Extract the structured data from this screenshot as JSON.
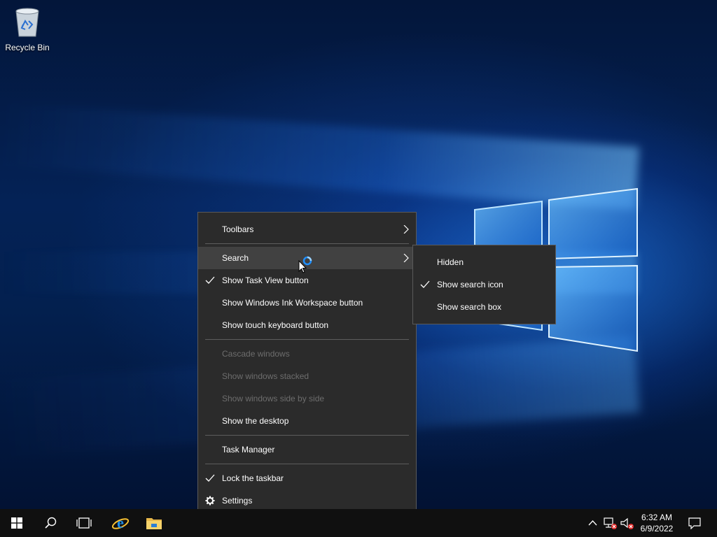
{
  "desktop": {
    "icons": [
      {
        "label": "Recycle Bin",
        "icon": "recycle-bin-icon"
      }
    ]
  },
  "context_menu": {
    "items": [
      {
        "label": "Toolbars",
        "checked": false,
        "enabled": true,
        "submenu": true
      },
      {
        "label": "Search",
        "checked": false,
        "enabled": true,
        "submenu": true,
        "highlighted": true
      },
      {
        "label": "Show Task View button",
        "checked": true,
        "enabled": true
      },
      {
        "label": "Show Windows Ink Workspace button",
        "checked": false,
        "enabled": true
      },
      {
        "label": "Show touch keyboard button",
        "checked": false,
        "enabled": true
      },
      {
        "label": "Cascade windows",
        "checked": false,
        "enabled": false
      },
      {
        "label": "Show windows stacked",
        "checked": false,
        "enabled": false
      },
      {
        "label": "Show windows side by side",
        "checked": false,
        "enabled": false
      },
      {
        "label": "Show the desktop",
        "checked": false,
        "enabled": true
      },
      {
        "label": "Task Manager",
        "checked": false,
        "enabled": true
      },
      {
        "label": "Lock the taskbar",
        "checked": true,
        "enabled": true
      },
      {
        "label": "Settings",
        "checked": false,
        "enabled": true,
        "icon": "gear-icon"
      }
    ]
  },
  "search_submenu": {
    "items": [
      {
        "label": "Hidden",
        "checked": false
      },
      {
        "label": "Show search icon",
        "checked": true
      },
      {
        "label": "Show search box",
        "checked": false
      }
    ]
  },
  "taskbar": {
    "pinned": [
      {
        "icon": "windows-start-icon"
      },
      {
        "icon": "search-icon"
      },
      {
        "icon": "task-view-icon"
      },
      {
        "icon": "internet-explorer-icon"
      },
      {
        "icon": "file-explorer-icon"
      }
    ],
    "tray": [
      {
        "icon": "chevron-up-icon"
      },
      {
        "icon": "network-disconnected-icon"
      },
      {
        "icon": "volume-muted-icon"
      }
    ],
    "clock": {
      "time": "6:32 AM",
      "date": "6/9/2022"
    },
    "notification_icon": "action-center-icon"
  },
  "colors": {
    "menu_bg": "#2b2b2b",
    "menu_hover": "#414141",
    "disabled_text": "#6d6d6d",
    "taskbar_bg": "#101010"
  }
}
